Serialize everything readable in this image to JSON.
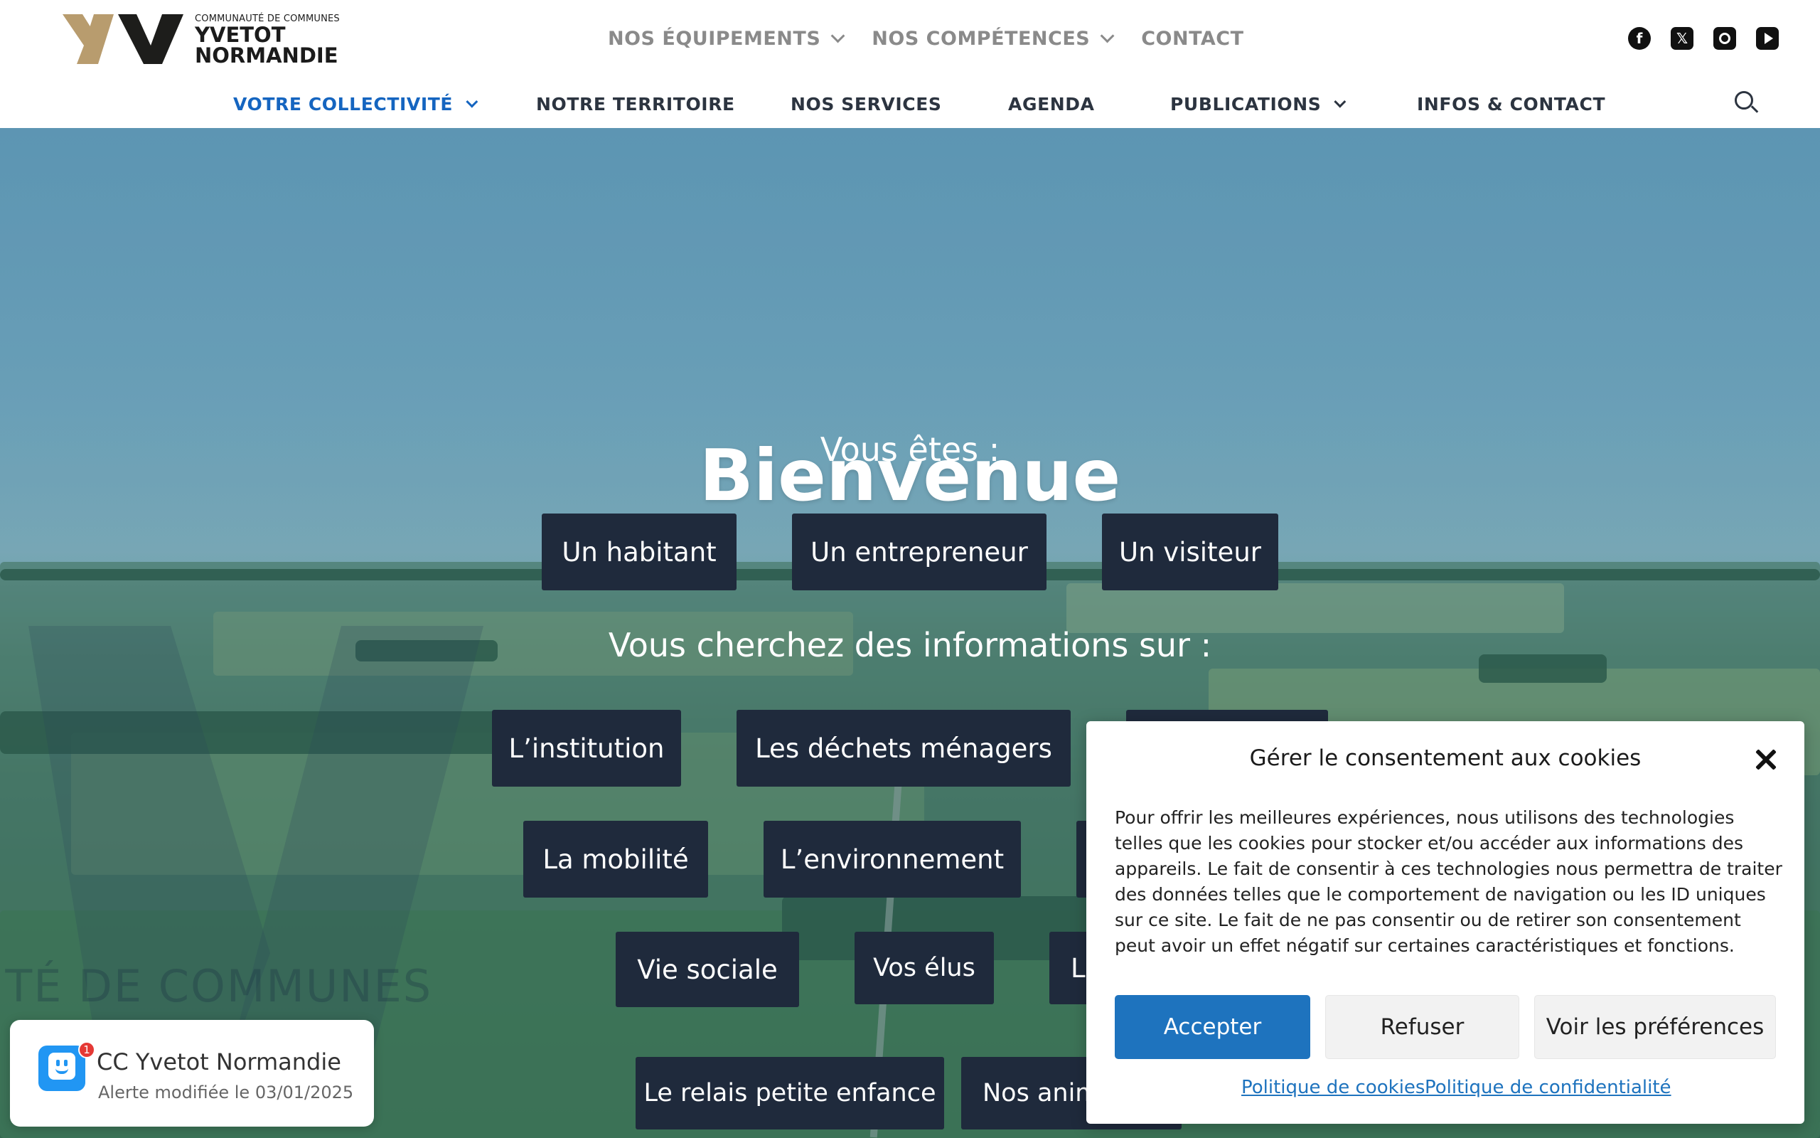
{
  "header": {
    "logo": {
      "small_text": "COMMUNAUTÉ DE COMMUNES",
      "line1": "YVETOT",
      "line2": "NORMANDIE",
      "colors": {
        "gold": "#b89c6e",
        "dark": "#1d1d1b"
      }
    },
    "top_nav": [
      {
        "label": "NOS ÉQUIPEMENTS",
        "has_dropdown": true
      },
      {
        "label": "NOS COMPÉTENCES",
        "has_dropdown": true
      },
      {
        "label": "CONTACT",
        "has_dropdown": false
      }
    ],
    "social": [
      "facebook-icon",
      "x-icon",
      "instagram-icon",
      "youtube-icon"
    ],
    "main_nav": [
      {
        "label": "VOTRE COLLECTIVITÉ",
        "has_dropdown": true,
        "active": true
      },
      {
        "label": "NOTRE TERRITOIRE",
        "has_dropdown": false
      },
      {
        "label": "NOS SERVICES",
        "has_dropdown": false
      },
      {
        "label": "AGENDA",
        "has_dropdown": false
      },
      {
        "label": "PUBLICATIONS",
        "has_dropdown": true
      },
      {
        "label": "INFOS & CONTACT",
        "has_dropdown": false
      }
    ],
    "active_color": "#1565c0"
  },
  "hero": {
    "title": "Bienvenue",
    "subtitle_profiles": "Vous êtes :",
    "profiles": [
      "Un habitant",
      "Un entrepreneur",
      "Un visiteur"
    ],
    "subtitle_topics": "Vous cherchez des informations sur :",
    "topics": [
      "L’institution",
      "Les déchets ménagers",
      "La mobilité",
      "L’environnement",
      "Vie sociale",
      "Vos élus",
      "Le",
      "Le relais petite enfance",
      "Nos anim"
    ],
    "watermark_text": "UTÉ DE COMMUNES",
    "button_color": "#1f2a3c"
  },
  "cookie_banner": {
    "title": "Gérer le consentement aux cookies",
    "body": "Pour offrir les meilleures expériences, nous utilisons des technologies telles que les cookies pour stocker et/ou accéder aux informations des appareils. Le fait de consentir à ces technologies nous permettra de traiter des données telles que le comportement de navigation ou les ID uniques sur ce site. Le fait de ne pas consentir ou de retirer son consentement peut avoir un effet négatif sur certaines caractéristiques et fonctions.",
    "accept": "Accepter",
    "refuse": "Refuser",
    "preferences": "Voir les préférences",
    "cookie_policy": "Politique de cookies",
    "privacy_policy": "Politique de confidentialité",
    "accent_color": "#1e73be"
  },
  "alert_widget": {
    "badge_count": "1",
    "title": "CC Yvetot Normandie",
    "subtitle": "Alerte modifiée le 03/01/2025"
  }
}
